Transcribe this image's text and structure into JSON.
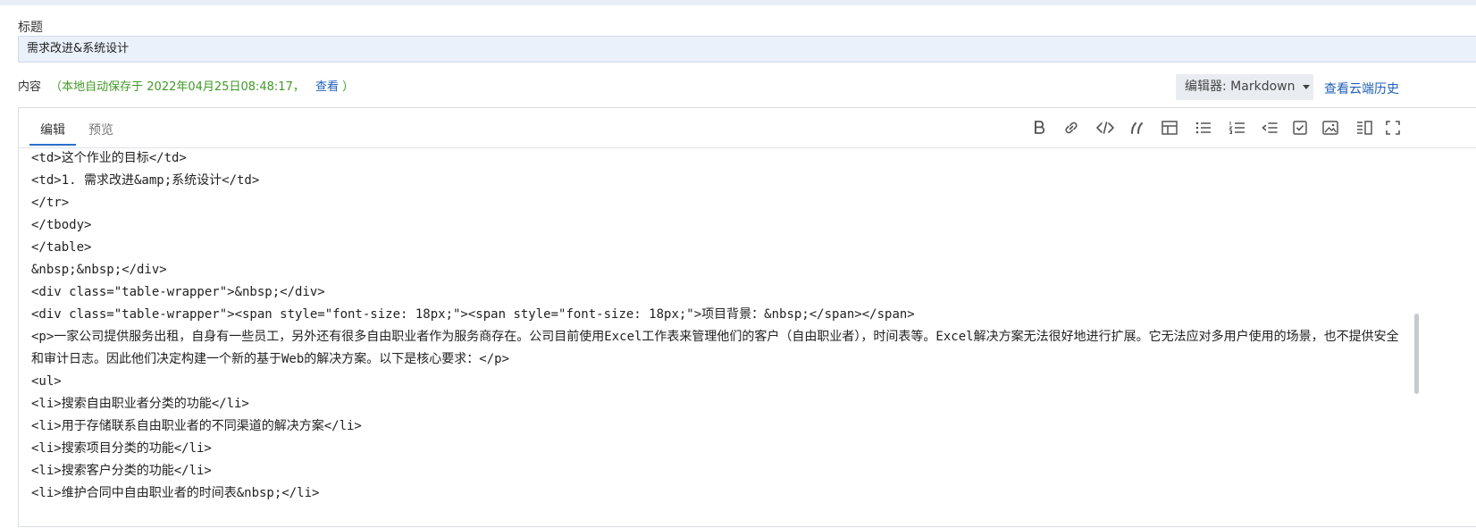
{
  "title": {
    "label": "标题",
    "value": "需求改进&系统设计"
  },
  "content": {
    "label": "内容",
    "autosave_text": "（本地自动保存于 2022年04月25日08:48:17，",
    "view_link": "查看",
    "autosave_close": "）"
  },
  "editor_select": {
    "label": "编辑器: Markdown"
  },
  "cloud_history_link": "查看云端历史",
  "tabs": [
    {
      "label": "编辑",
      "active": true
    },
    {
      "label": "预览",
      "active": false
    }
  ],
  "toolbar": {
    "icons": [
      "bold-icon",
      "link-icon",
      "code-icon",
      "quote-icon",
      "table-icon",
      "unordered-list-icon",
      "ordered-list-icon",
      "outdent-icon",
      "checkbox-icon",
      "image-icon",
      "split-view-icon",
      "fullscreen-icon"
    ]
  },
  "code_lines": [
    "<td>这个作业的目标</td>",
    "<td>1. 需求改进&amp;系统设计</td>",
    "</tr>",
    "</tbody>",
    "</table>",
    "&nbsp;&nbsp;</div>",
    "<div class=\"table-wrapper\">&nbsp;</div>",
    "<div class=\"table-wrapper\"><span style=\"font-size: 18px;\"><span style=\"font-size: 18px;\">项目背景：&nbsp;</span></span>",
    "<p>一家公司提供服务出租，自身有一些员工，另外还有很多自由职业者作为服务商存在。公司目前使用Excel工作表来管理他们的客户（自由职业者），时间表等。Excel解决方案无法很好地进行扩展。它无法应对多用户使用的场景，也不提供安全和审计日志。因此他们决定构建一个新的基于Web的解决方案。以下是核心要求：</p>",
    "<ul>",
    "<li>搜索自由职业者分类的功能</li>",
    "<li>用于存储联系自由职业者的不同渠道的解决方案</li>",
    "<li>搜索项目分类的功能</li>",
    "<li>搜索客户分类的功能</li>",
    "<li>维护合同中自由职业者的时间表&nbsp;</li>"
  ]
}
